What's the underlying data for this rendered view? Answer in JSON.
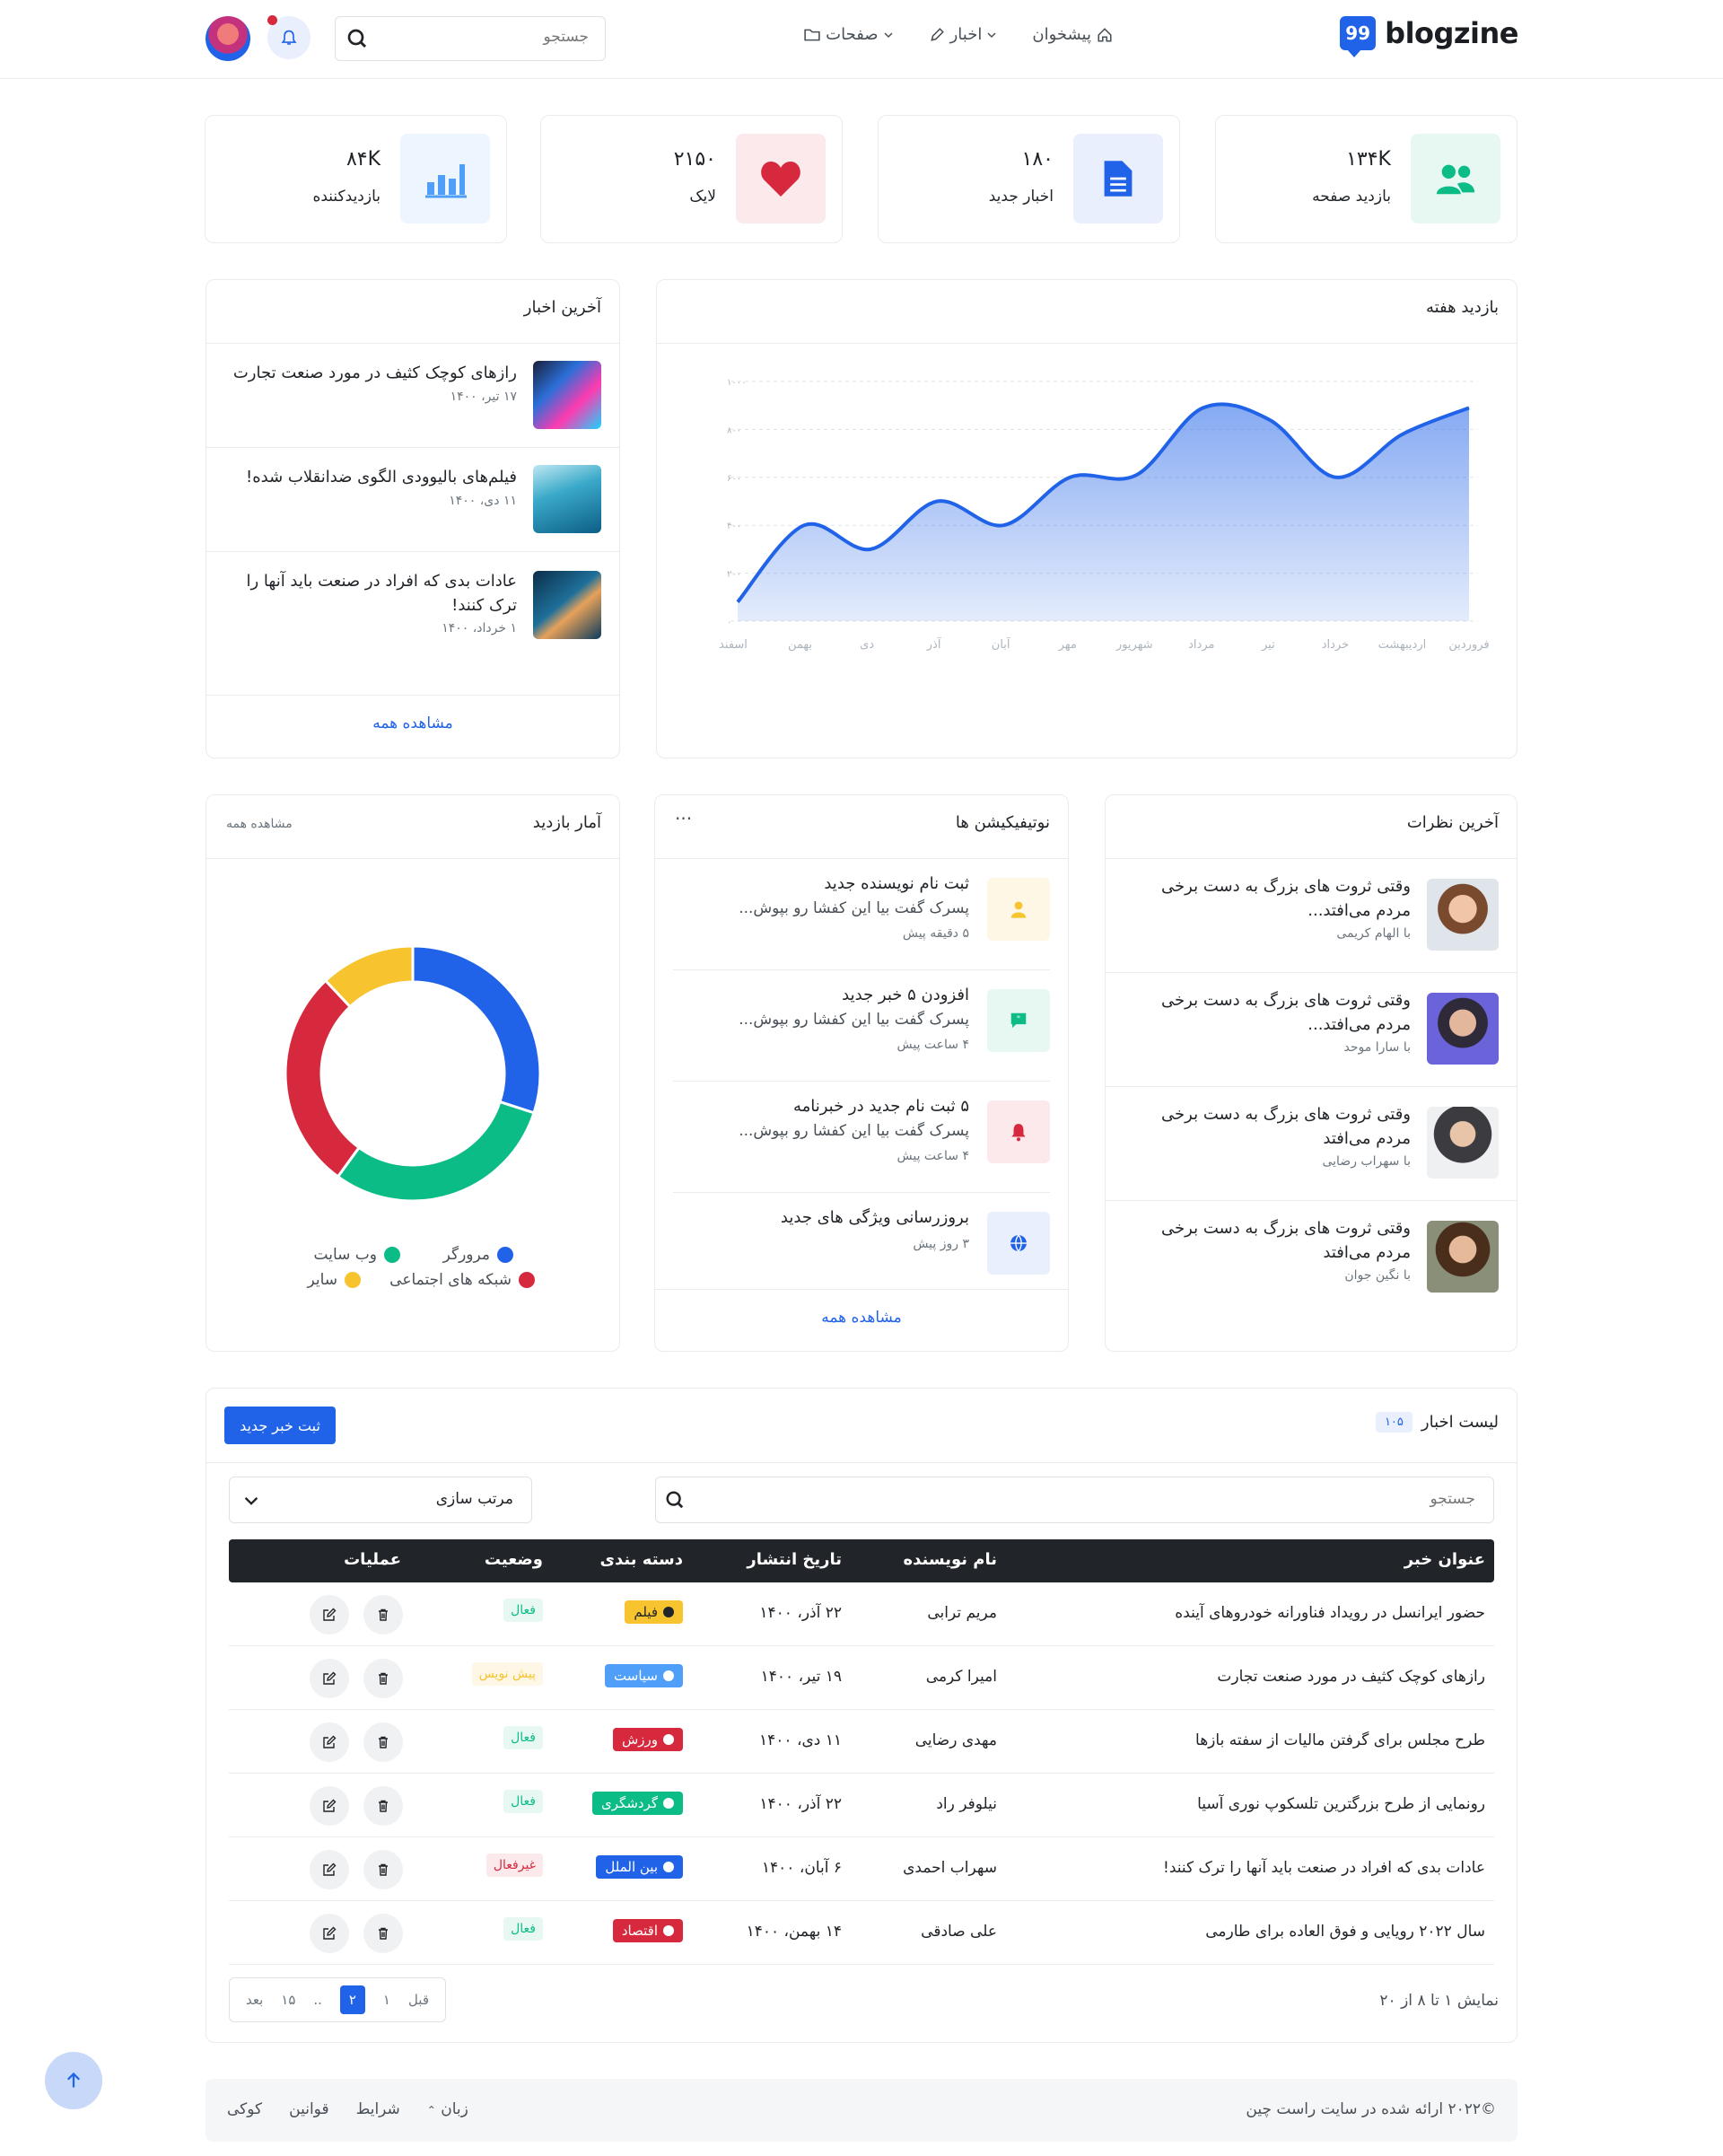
{
  "brand": {
    "name": "blogzine",
    "logo_glyph": "99"
  },
  "nav": [
    {
      "label": "پیشخوان",
      "icon": "home-icon"
    },
    {
      "label": "اخبار",
      "icon": "pencil-icon"
    },
    {
      "label": "صفحات",
      "icon": "folder-icon"
    }
  ],
  "search": {
    "placeholder": "جستجو"
  },
  "stats": [
    {
      "value": "۱۳۴K",
      "label": "بازدید صفحه",
      "icon": "people-icon",
      "color": "#0cbc87",
      "bg": "#e7f8f3"
    },
    {
      "value": "۱۸۰",
      "label": "اخبار جدید",
      "icon": "file-icon",
      "color": "#2163e8",
      "bg": "#e9effd"
    },
    {
      "value": "۲۱۵۰",
      "label": "لایک",
      "icon": "heart-icon",
      "color": "#d6293e",
      "bg": "#fbe9eb"
    },
    {
      "value": "۸۴K",
      "label": "بازدیدکننده",
      "icon": "bar-chart-icon",
      "color": "#4f9ef8",
      "bg": "#edf5fe"
    }
  ],
  "latest_news": {
    "title": "آخرین اخبار",
    "items": [
      {
        "title": "رازهای کوچک کثیف در مورد صنعت تجارت",
        "date": "۱۷ تیر، ۱۴۰۰"
      },
      {
        "title": "فیلم‌های بالیوودی الگوی ضدانقلاب شده!",
        "date": "۱۱ دی، ۱۴۰۰"
      },
      {
        "title": "عادات بدی که افراد در صنعت باید آنها را ترک کنند!",
        "date": "۱ خرداد، ۱۴۰۰"
      }
    ],
    "view_all": "مشاهده همه"
  },
  "weekly": {
    "title": "بازدید هفته"
  },
  "chart_data": {
    "type": "area",
    "title": "بازدید هفته",
    "categories": [
      "فروردین",
      "اردیبهشت",
      "خرداد",
      "تیر",
      "مرداد",
      "شهریور",
      "مهر",
      "آبان",
      "آذر",
      "دی",
      "بهمن",
      "اسفند"
    ],
    "ylim": [
      0,
      1000
    ],
    "yticks": [
      "۰",
      "۲۰۰",
      "۴۰۰",
      "۶۰۰",
      "۸۰۰",
      "۱۰۰۰"
    ],
    "values": [
      80,
      400,
      300,
      500,
      400,
      600,
      610,
      890,
      840,
      600,
      780,
      890
    ],
    "color": "#2163e8",
    "grid": true
  },
  "visit_stats": {
    "title": "آمار بازدید",
    "view_all": "مشاهده همه",
    "segments": [
      {
        "name": "مرورگر",
        "value": 30,
        "color": "#2163e8"
      },
      {
        "name": "وب سایت",
        "value": 30,
        "color": "#0cbc87"
      },
      {
        "name": "شبکه های اجتماعی",
        "value": 28,
        "color": "#d6293e"
      },
      {
        "name": "سایر",
        "value": 12,
        "color": "#f7c32e"
      }
    ]
  },
  "notifications": {
    "title": "نوتیفیکیشن ها",
    "more": "···",
    "items": [
      {
        "title": "ثبت نام نویسنده جدید",
        "desc": "پسرک گفت بیا این کفشا رو بپوش...",
        "time": "۵ دقیقه پیش",
        "icon": "user-icon",
        "color": "#f7c32e",
        "bg": "#fef7e6"
      },
      {
        "title": "افزودن ۵ خبر جدید",
        "desc": "پسرک گفت بیا این کفشا رو بپوش...",
        "time": "۴ ساعت پیش",
        "icon": "quote-icon",
        "color": "#0cbc87",
        "bg": "#e7f8f3"
      },
      {
        "title": "۵ ثبت نام جدید در خبرنامه",
        "desc": "پسرک گفت بیا این کفشا رو بپوش...",
        "time": "۴ ساعت پیش",
        "icon": "bell-icon",
        "color": "#d6293e",
        "bg": "#fbe9eb"
      },
      {
        "title": "بروزرسانی ویژگی های جدید",
        "desc": "",
        "time": "۳ روز پیش",
        "icon": "globe-icon",
        "color": "#2163e8",
        "bg": "#e9effd"
      }
    ],
    "view_all": "مشاهده همه"
  },
  "comments": {
    "title": "آخرین نظرات",
    "items": [
      {
        "text": "وقتی ثروت های بزرگ به دست برخی مردم می‌افتد...",
        "by": "با الهام کریمی"
      },
      {
        "text": "وقتی ثروت های بزرگ به دست برخی مردم می‌افتد...",
        "by": "با سارا موحد"
      },
      {
        "text": "وقتی ثروت های بزرگ به دست برخی مردم می‌افتد",
        "by": "با سهراب رضایی"
      },
      {
        "text": "وقتی ثروت های بزرگ به دست برخی مردم می‌افتد",
        "by": "با نگین جوان"
      }
    ]
  },
  "news_list": {
    "title": "لیست اخبار",
    "count": "۱۰۵",
    "add_button": "ثبت خبر جدید",
    "search_placeholder": "جستجو",
    "sort_label": "مرتب سازی",
    "columns": [
      "عنوان خبر",
      "نام نویسنده",
      "تاریخ انتشار",
      "دسته بندی",
      "وضعیت",
      "عملیات"
    ],
    "rows": [
      {
        "title": "حضور ایرانسل در رویداد فناورانه خودروهای آینده",
        "author": "مریم ترابی",
        "date": "۲۲ آذر، ۱۴۰۰",
        "category": "فیلم",
        "cat_color": "#f7c32e",
        "cat_text": "#212529",
        "status": "فعال",
        "status_color": "#0cbc87",
        "status_bg": "#e7f8f3"
      },
      {
        "title": "رازهای کوچک کثیف در مورد صنعت تجارت",
        "author": "امیرا کرمی",
        "date": "۱۹ تیر، ۱۴۰۰",
        "category": "سیاست",
        "cat_color": "#4f9ef8",
        "cat_text": "#ffffff",
        "status": "پیش نویس",
        "status_color": "#f7c32e",
        "status_bg": "#fef7e6"
      },
      {
        "title": "طرح مجلس برای گرفتن مالیات از سفته بازها",
        "author": "مهدی رضایی",
        "date": "۱۱ دی، ۱۴۰۰",
        "category": "ورزش",
        "cat_color": "#d6293e",
        "cat_text": "#ffffff",
        "status": "فعال",
        "status_color": "#0cbc87",
        "status_bg": "#e7f8f3"
      },
      {
        "title": "رونمایی از طرح بزرگترین تلسکوپ نوری آسیا",
        "author": "نیلوفر راد",
        "date": "۲۲ آذر، ۱۴۰۰",
        "category": "گردشگری",
        "cat_color": "#0cbc87",
        "cat_text": "#ffffff",
        "status": "فعال",
        "status_color": "#0cbc87",
        "status_bg": "#e7f8f3"
      },
      {
        "title": "عادات بدی که افراد در صنعت باید آنها را ترک کنند!",
        "author": "سهراب احمدی",
        "date": "۶ آبان، ۱۴۰۰",
        "category": "بین الملل",
        "cat_color": "#2163e8",
        "cat_text": "#ffffff",
        "status": "غیرفعال",
        "status_color": "#d6293e",
        "status_bg": "#fbe9eb"
      },
      {
        "title": "سال ۲۰۲۲ رویایی و فوق العاده برای طارمی",
        "author": "علی صادقی",
        "date": "۱۴ بهمن، ۱۴۰۰",
        "category": "اقتصاد",
        "cat_color": "#d6293e",
        "cat_text": "#ffffff",
        "status": "فعال",
        "status_color": "#0cbc87",
        "status_bg": "#e7f8f3"
      }
    ],
    "summary": "نمایش ۱ تا ۸ از ۲۰",
    "pager": {
      "prev": "قبل",
      "pages": [
        "۱",
        "۲",
        "..",
        "۱۵"
      ],
      "active": "۲",
      "next": "بعد"
    }
  },
  "footer": {
    "copyright": "©۲۰۲۲ ارائه شده در سایت راست چین",
    "links": [
      "زبان",
      "شرایط",
      "قوانین",
      "کوکی"
    ]
  }
}
